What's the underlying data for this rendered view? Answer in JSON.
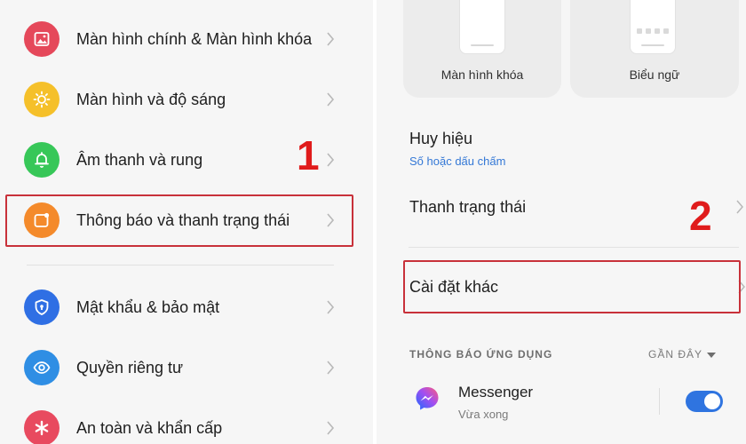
{
  "left_menu": {
    "items": [
      {
        "label": "Màn hình chính & Màn hình khóa",
        "icon": "image-icon",
        "color": "#e5485a"
      },
      {
        "label": "Màn hình và độ sáng",
        "icon": "sun-icon",
        "color": "#f5c02a"
      },
      {
        "label": "Âm thanh và rung",
        "icon": "bell-icon",
        "color": "#37c758"
      },
      {
        "label": "Thông báo và thanh trạng thái",
        "icon": "notification-icon",
        "color": "#f48a2b"
      },
      {
        "label": "Mật khẩu & bảo mật",
        "icon": "shield-icon",
        "color": "#2f6fe4"
      },
      {
        "label": "Quyền riêng tư",
        "icon": "eye-icon",
        "color": "#2f8ee4"
      },
      {
        "label": "An toàn và khẩn cấp",
        "icon": "asterisk-icon",
        "color": "#e84a5f"
      }
    ]
  },
  "step_markers": {
    "first": "1",
    "second": "2"
  },
  "right_panel": {
    "cards": [
      {
        "label": "Màn hình khóa"
      },
      {
        "label": "Biểu ngữ"
      }
    ],
    "badge": {
      "title": "Huy hiệu",
      "subtitle": "Số hoặc dấu chấm"
    },
    "status_bar": {
      "title": "Thanh trạng thái"
    },
    "other_settings": {
      "title": "Cài đặt khác"
    },
    "app_notifications": {
      "section_title": "THÔNG BÁO ỨNG DỤNG",
      "sort_label": "GẦN ĐÂY",
      "apps": [
        {
          "name": "Messenger",
          "time": "Vừa xong",
          "enabled": true
        }
      ]
    }
  },
  "colors": {
    "accent": "#2f74e0",
    "highlight_border": "#c8313a",
    "step_number": "#e01b1b"
  }
}
